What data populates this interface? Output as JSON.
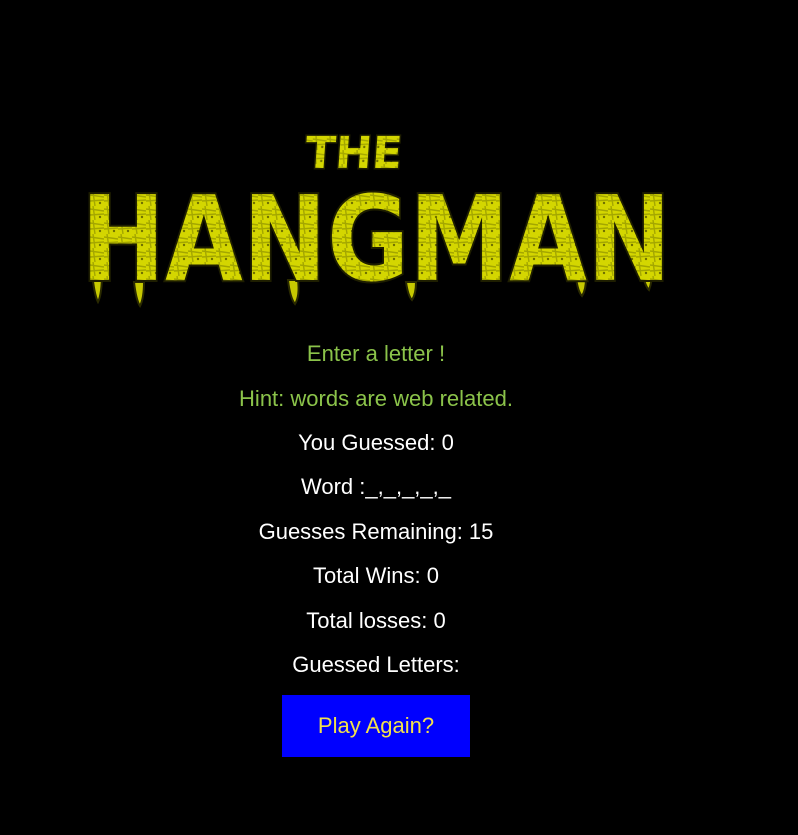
{
  "logo": {
    "small_text": "THE",
    "big_text": "HANGMAN",
    "fill_color": "#d4d600",
    "outline_color": "#2a2a00"
  },
  "prompt": "Enter a letter !",
  "hint": "Hint: words are web related.",
  "you_guessed": "You Guessed: 0",
  "word": "Word :_,_,_,_,_",
  "guesses_remaining": "Guesses Remaining: 15",
  "total_wins": "Total Wins: 0",
  "total_losses": "Total losses: 0",
  "guessed_letters": "Guessed Letters:",
  "play_again_button": "Play Again?",
  "colors": {
    "background": "#000000",
    "hint_text": "#8bc34a",
    "body_text": "#ffffff",
    "button_bg": "#0000ff",
    "button_text": "#f2e14c"
  }
}
